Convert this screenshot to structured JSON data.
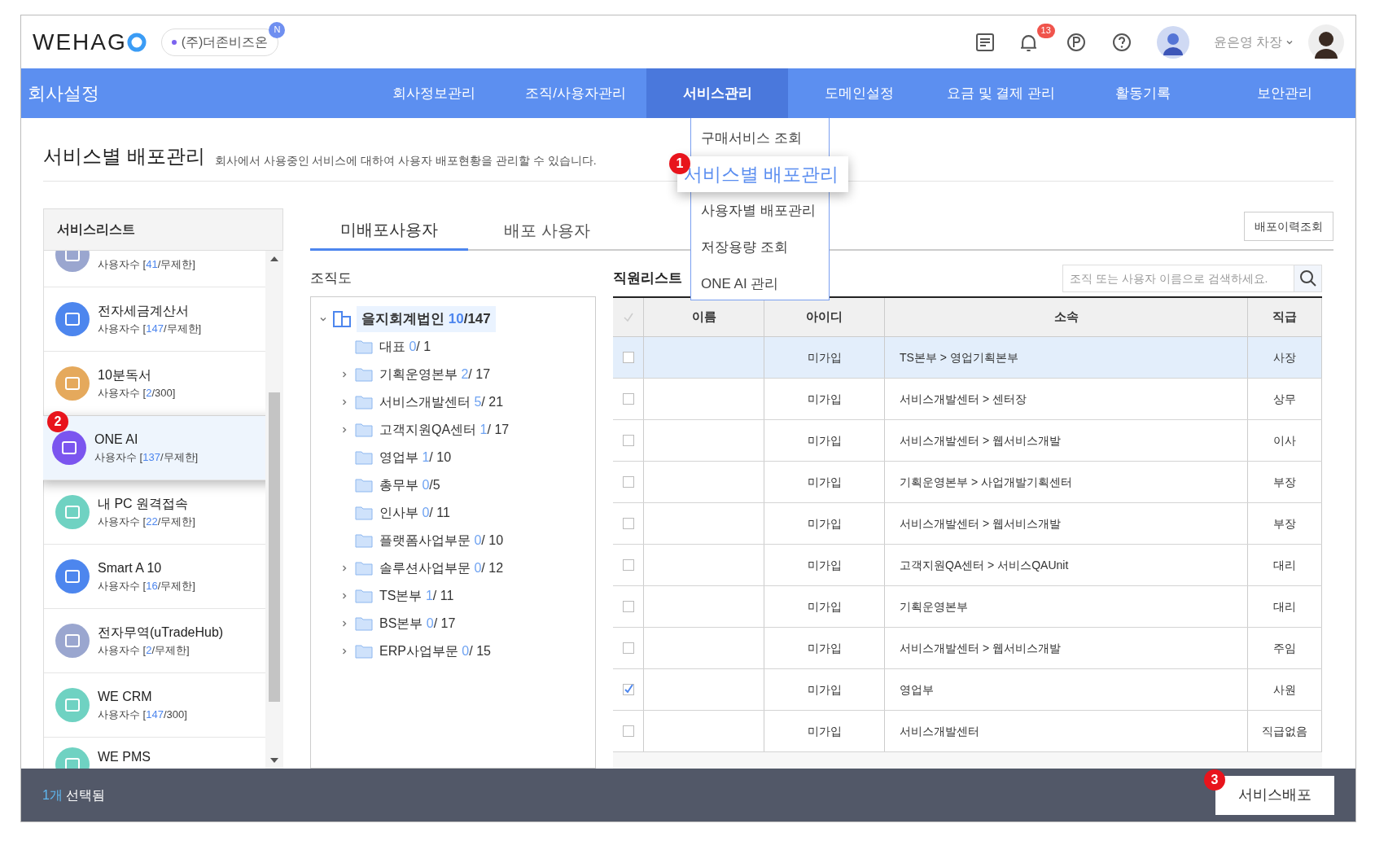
{
  "header": {
    "logo": "WEHAG",
    "company": "(주)더존비즈온",
    "company_badge": "N",
    "notification_count": "13",
    "user_name": "윤은영 차장"
  },
  "nav": {
    "title": "회사설정",
    "tabs": [
      {
        "label": "회사정보관리",
        "selected": false
      },
      {
        "label": "조직/사용자관리",
        "selected": false
      },
      {
        "label": "서비스관리",
        "selected": true
      },
      {
        "label": "도메인설정",
        "selected": false
      },
      {
        "label": "요금 및 결제 관리",
        "selected": false
      },
      {
        "label": "활동기록",
        "selected": false
      },
      {
        "label": "보안관리",
        "selected": false
      }
    ]
  },
  "dropdown": {
    "items": [
      {
        "label": "구매서비스 조회",
        "selected": false
      },
      {
        "label": "서비스별 배포관리",
        "selected": true,
        "badge": "1"
      },
      {
        "label": "사용자별 배포관리",
        "selected": false
      },
      {
        "label": "저장용량 조회",
        "selected": false
      },
      {
        "label": "ONE AI 관리",
        "selected": false
      }
    ]
  },
  "page": {
    "title": "서비스별 배포관리",
    "description": "회사에서 사용중인 서비스에 대하여 사용자 배포현황을 관리할 수 있습니다."
  },
  "sidebar": {
    "title": "서비스리스트",
    "items": [
      {
        "count_prefix": "사용자수 [",
        "count_used": "41",
        "count_rest": "/무제한]",
        "color": "#9aa6cf",
        "selected": false
      },
      {
        "name": "전자세금계산서",
        "count_prefix": "사용자수 [",
        "count_used": "147",
        "count_rest": "/무제한]",
        "color": "#4d86ee",
        "selected": false
      },
      {
        "name": "10분독서",
        "count_prefix": "사용자수 [",
        "count_used": "2",
        "count_rest": "/300]",
        "color": "#e5a95c",
        "selected": false
      },
      {
        "name": "ONE AI",
        "count_prefix": "사용자수 [",
        "count_used": "137",
        "count_rest": "/무제한]",
        "color": "#7b55ef",
        "selected": true,
        "badge": "2"
      },
      {
        "name": "내 PC 원격접속",
        "count_prefix": "사용자수 [",
        "count_used": "22",
        "count_rest": "/무제한]",
        "color": "#6fd2c2",
        "selected": false
      },
      {
        "name": "Smart A 10",
        "count_prefix": "사용자수 [",
        "count_used": "16",
        "count_rest": "/무제한]",
        "color": "#4d86ee",
        "selected": false
      },
      {
        "name": "전자무역(uTradeHub)",
        "count_prefix": "사용자수 [",
        "count_used": "2",
        "count_rest": "/무제한]",
        "color": "#9aa6cf",
        "selected": false
      },
      {
        "name": "WE CRM",
        "count_prefix": "사용자수 [",
        "count_used": "147",
        "count_rest": "/300]",
        "color": "#6fd2c2",
        "selected": false
      },
      {
        "name": "WE PMS",
        "color": "#6fd2c2",
        "selected": false
      }
    ]
  },
  "tabs": [
    {
      "label": "미배포사용자",
      "selected": true
    },
    {
      "label": "배포 사용자",
      "selected": false
    }
  ],
  "history_button": "배포이력조회",
  "org": {
    "title": "조직도",
    "root": {
      "name": "을지회계법인",
      "count": "10",
      "total": "/147",
      "expanded": true,
      "selected": true,
      "children": [
        {
          "name": "대표",
          "count": "0",
          "total": "/ 1",
          "expandable": false
        },
        {
          "name": "기획운영본부",
          "count": "2",
          "total": "/ 17",
          "expandable": true
        },
        {
          "name": "서비스개발센터",
          "count": "5",
          "total": "/ 21",
          "expandable": true
        },
        {
          "name": "고객지원QA센터",
          "count": "1",
          "total": "/ 17",
          "expandable": true
        },
        {
          "name": "영업부",
          "count": "1",
          "total": "/ 10",
          "expandable": false
        },
        {
          "name": "총무부",
          "count": "0",
          "total": "/5",
          "expandable": false
        },
        {
          "name": "인사부",
          "count": "0",
          "total": "/ 11",
          "expandable": false
        },
        {
          "name": "플랫폼사업부문",
          "count": "0",
          "total": "/ 10",
          "expandable": false
        },
        {
          "name": "솔루션사업부문",
          "count": "0",
          "total": "/ 12",
          "expandable": true
        },
        {
          "name": "TS본부",
          "count": "1",
          "total": "/ 11",
          "expandable": true
        },
        {
          "name": "BS본부",
          "count": "0",
          "total": "/ 17",
          "expandable": true
        },
        {
          "name": "ERP사업부문",
          "count": "0",
          "total": "/ 15",
          "expandable": true
        }
      ]
    }
  },
  "employees": {
    "title": "직원리스트",
    "search": {
      "placeholder": "조직 또는 사용자 이름으로 검색하세요."
    },
    "select_all_checked": false,
    "columns": [
      "이름",
      "아이디",
      "소속",
      "직급"
    ],
    "rows": [
      {
        "id": "미가입",
        "affiliation": "TS본부 > 영업기획본부",
        "rank": "사장",
        "checked": false,
        "selected": true
      },
      {
        "id": "미가입",
        "affiliation": "서비스개발센터 > 센터장",
        "rank": "상무",
        "checked": false,
        "selected": false
      },
      {
        "id": "미가입",
        "affiliation": "서비스개발센터 > 웹서비스개발",
        "rank": "이사",
        "checked": false,
        "selected": false
      },
      {
        "id": "미가입",
        "affiliation": "기획운영본부 > 사업개발기획센터",
        "rank": "부장",
        "checked": false,
        "selected": false
      },
      {
        "id": "미가입",
        "affiliation": "서비스개발센터 > 웹서비스개발",
        "rank": "부장",
        "checked": false,
        "selected": false
      },
      {
        "id": "미가입",
        "affiliation": "고객지원QA센터 > 서비스QAUnit",
        "rank": "대리",
        "checked": false,
        "selected": false
      },
      {
        "id": "미가입",
        "affiliation": "기획운영본부",
        "rank": "대리",
        "checked": false,
        "selected": false
      },
      {
        "id": "미가입",
        "affiliation": "서비스개발센터 > 웹서비스개발",
        "rank": "주임",
        "checked": false,
        "selected": false
      },
      {
        "id": "미가입",
        "affiliation": "영업부",
        "rank": "사원",
        "checked": true,
        "selected": false
      },
      {
        "id": "미가입",
        "affiliation": "서비스개발센터",
        "rank": "직급없음",
        "checked": false,
        "selected": false
      }
    ]
  },
  "footer": {
    "selected_count": "1개",
    "selected_label": "선택됨",
    "deploy_button": "서비스배포",
    "deploy_badge": "3"
  }
}
